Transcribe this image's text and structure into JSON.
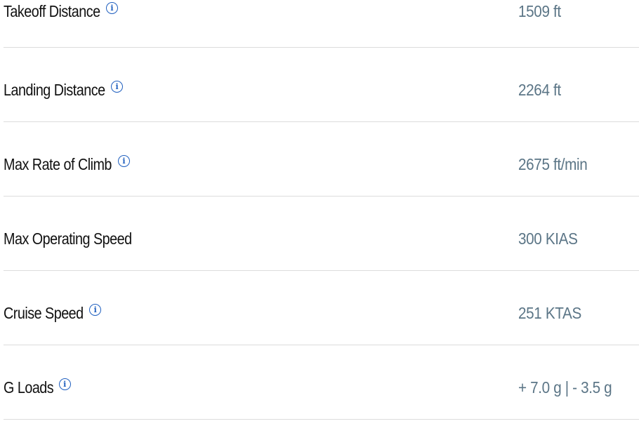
{
  "specs": [
    {
      "label": "Takeoff Distance",
      "value": "1509 ft",
      "info_icon": "info-icon",
      "has_info": true
    },
    {
      "label": "Landing Distance",
      "value": "2264 ft",
      "info_icon": "info-icon",
      "has_info": true
    },
    {
      "label": "Max Rate of Climb",
      "value": "2675 ft/min",
      "info_icon": "info-icon",
      "has_info": true
    },
    {
      "label": "Max Operating Speed",
      "value": "300 KIAS",
      "has_info": false
    },
    {
      "label": "Cruise Speed",
      "value": "251 KTAS",
      "info_icon": "info-icon",
      "has_info": true
    },
    {
      "label": "G Loads",
      "value": "+ 7.0 g | - 3.5 g",
      "info_icon": "info-icon",
      "has_info": true
    }
  ],
  "colors": {
    "label": "#111111",
    "value": "#5b7586",
    "info_icon": "#1f5fbf",
    "divider": "#dcdcdc"
  }
}
